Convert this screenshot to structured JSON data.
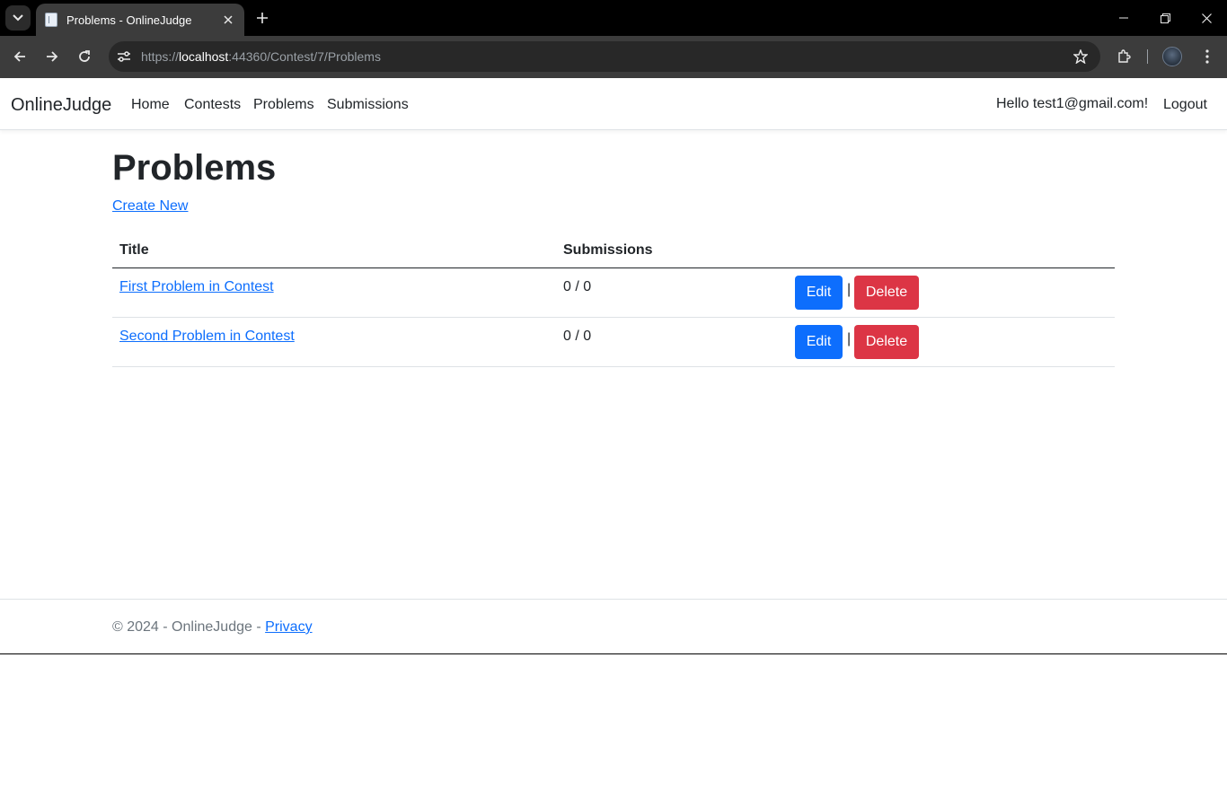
{
  "browser": {
    "tab_title": "Problems - OnlineJudge",
    "url_scheme": "https://",
    "url_host": "localhost",
    "url_rest": ":44360/Contest/7/Problems"
  },
  "navbar": {
    "brand": "OnlineJudge",
    "links": [
      "Home",
      "Contests",
      "Problems",
      "Submissions"
    ],
    "greeting": "Hello test1@gmail.com!",
    "logout": "Logout"
  },
  "main": {
    "title": "Problems",
    "create_new": "Create New",
    "table": {
      "headers": [
        "Title",
        "Submissions"
      ],
      "rows": [
        {
          "title": "First Problem in Contest",
          "submissions": "0 / 0"
        },
        {
          "title": "Second Problem in Contest",
          "submissions": "0 / 0"
        }
      ],
      "edit_label": "Edit",
      "separator": "|",
      "delete_label": "Delete"
    }
  },
  "footer": {
    "text": "© 2024 - OnlineJudge - ",
    "privacy": "Privacy"
  },
  "colors": {
    "primary": "#0d6efd",
    "danger": "#dc3545",
    "text": "#212529",
    "muted": "#6c757d"
  }
}
